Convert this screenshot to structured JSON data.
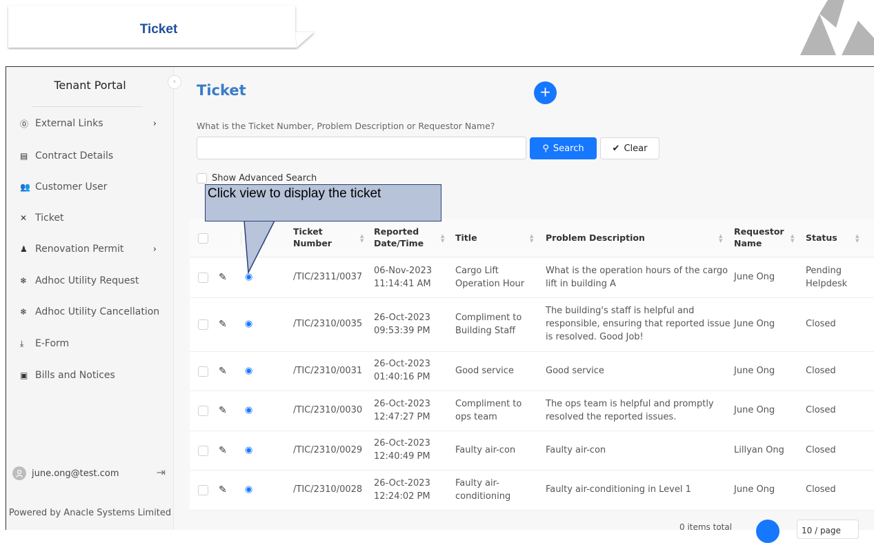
{
  "banner": {
    "title": "Ticket"
  },
  "sidebar": {
    "title": "Tenant Portal",
    "items": [
      {
        "label": "External Links",
        "icon": "question-circle-icon",
        "has_chevron": true
      },
      {
        "label": "Contract Details",
        "icon": "document-icon",
        "has_chevron": false
      },
      {
        "label": "Customer User",
        "icon": "users-icon",
        "has_chevron": false
      },
      {
        "label": "Ticket",
        "icon": "tools-icon",
        "has_chevron": false
      },
      {
        "label": "Renovation Permit",
        "icon": "worker-icon",
        "has_chevron": true
      },
      {
        "label": "Adhoc Utility Request",
        "icon": "snowflake-icon",
        "has_chevron": false
      },
      {
        "label": "Adhoc Utility Cancellation",
        "icon": "snowflake-icon",
        "has_chevron": false
      },
      {
        "label": "E-Form",
        "icon": "download-icon",
        "has_chevron": false
      },
      {
        "label": "Bills and Notices",
        "icon": "money-icon",
        "has_chevron": false
      }
    ],
    "user_email": "june.ong@test.com",
    "powered_by": "Powered by Anacle Systems Limited"
  },
  "main": {
    "title": "Ticket",
    "search_label": "What is the Ticket Number, Problem Description or Requestor Name?",
    "search_value": "",
    "search_button": "Search",
    "clear_button": "Clear",
    "advanced_search_label": "Show Advanced Search"
  },
  "callout": {
    "text": "Click view to display the ticket"
  },
  "table": {
    "headers": {
      "ticket_number": "Ticket Number",
      "reported": "Reported Date/Time",
      "title": "Title",
      "problem": "Problem Description",
      "requestor": "Requestor Name",
      "status": "Status"
    },
    "rows": [
      {
        "ticket_number": "/TIC/2311/0037",
        "date": "06-Nov-2023",
        "time": "11:14:41 AM",
        "title": "Cargo Lift Operation Hour",
        "problem": "What is the operation hours of the cargo lift in building A",
        "requestor": "June Ong",
        "status": "Pending Helpdesk"
      },
      {
        "ticket_number": "/TIC/2310/0035",
        "date": "26-Oct-2023",
        "time": "09:53:39 PM",
        "title": "Compliment to Building Staff",
        "problem": "The building's staff is helpful and responsible, ensuring that reported issue is resolved. Good Job!",
        "requestor": "June Ong",
        "status": "Closed"
      },
      {
        "ticket_number": "/TIC/2310/0031",
        "date": "26-Oct-2023",
        "time": "01:40:16 PM",
        "title": "Good service",
        "problem": "Good service",
        "requestor": "June Ong",
        "status": "Closed"
      },
      {
        "ticket_number": "/TIC/2310/0030",
        "date": "26-Oct-2023",
        "time": "12:47:27 PM",
        "title": "Compliment to ops team",
        "problem": "The ops team is helpful and promptly resolved the reported issues.",
        "requestor": "June Ong",
        "status": "Closed"
      },
      {
        "ticket_number": "/TIC/2310/0029",
        "date": "26-Oct-2023",
        "time": "12:40:49 PM",
        "title": "Faulty air-con",
        "problem": "Faulty air-con",
        "requestor": "Lillyan Ong",
        "status": "Closed"
      },
      {
        "ticket_number": "/TIC/2310/0028",
        "date": "26-Oct-2023",
        "time": "12:24:02 PM",
        "title": "Faulty air-conditioning",
        "problem": "Faulty air-conditioning in Level 1",
        "requestor": "June Ong",
        "status": "Closed"
      }
    ]
  },
  "pagination": {
    "summary": "0 items total",
    "page_size": "10 / page"
  },
  "colors": {
    "accent": "#1677ff",
    "title": "#3a7bc8",
    "banner_title": "#1f4e9e"
  }
}
